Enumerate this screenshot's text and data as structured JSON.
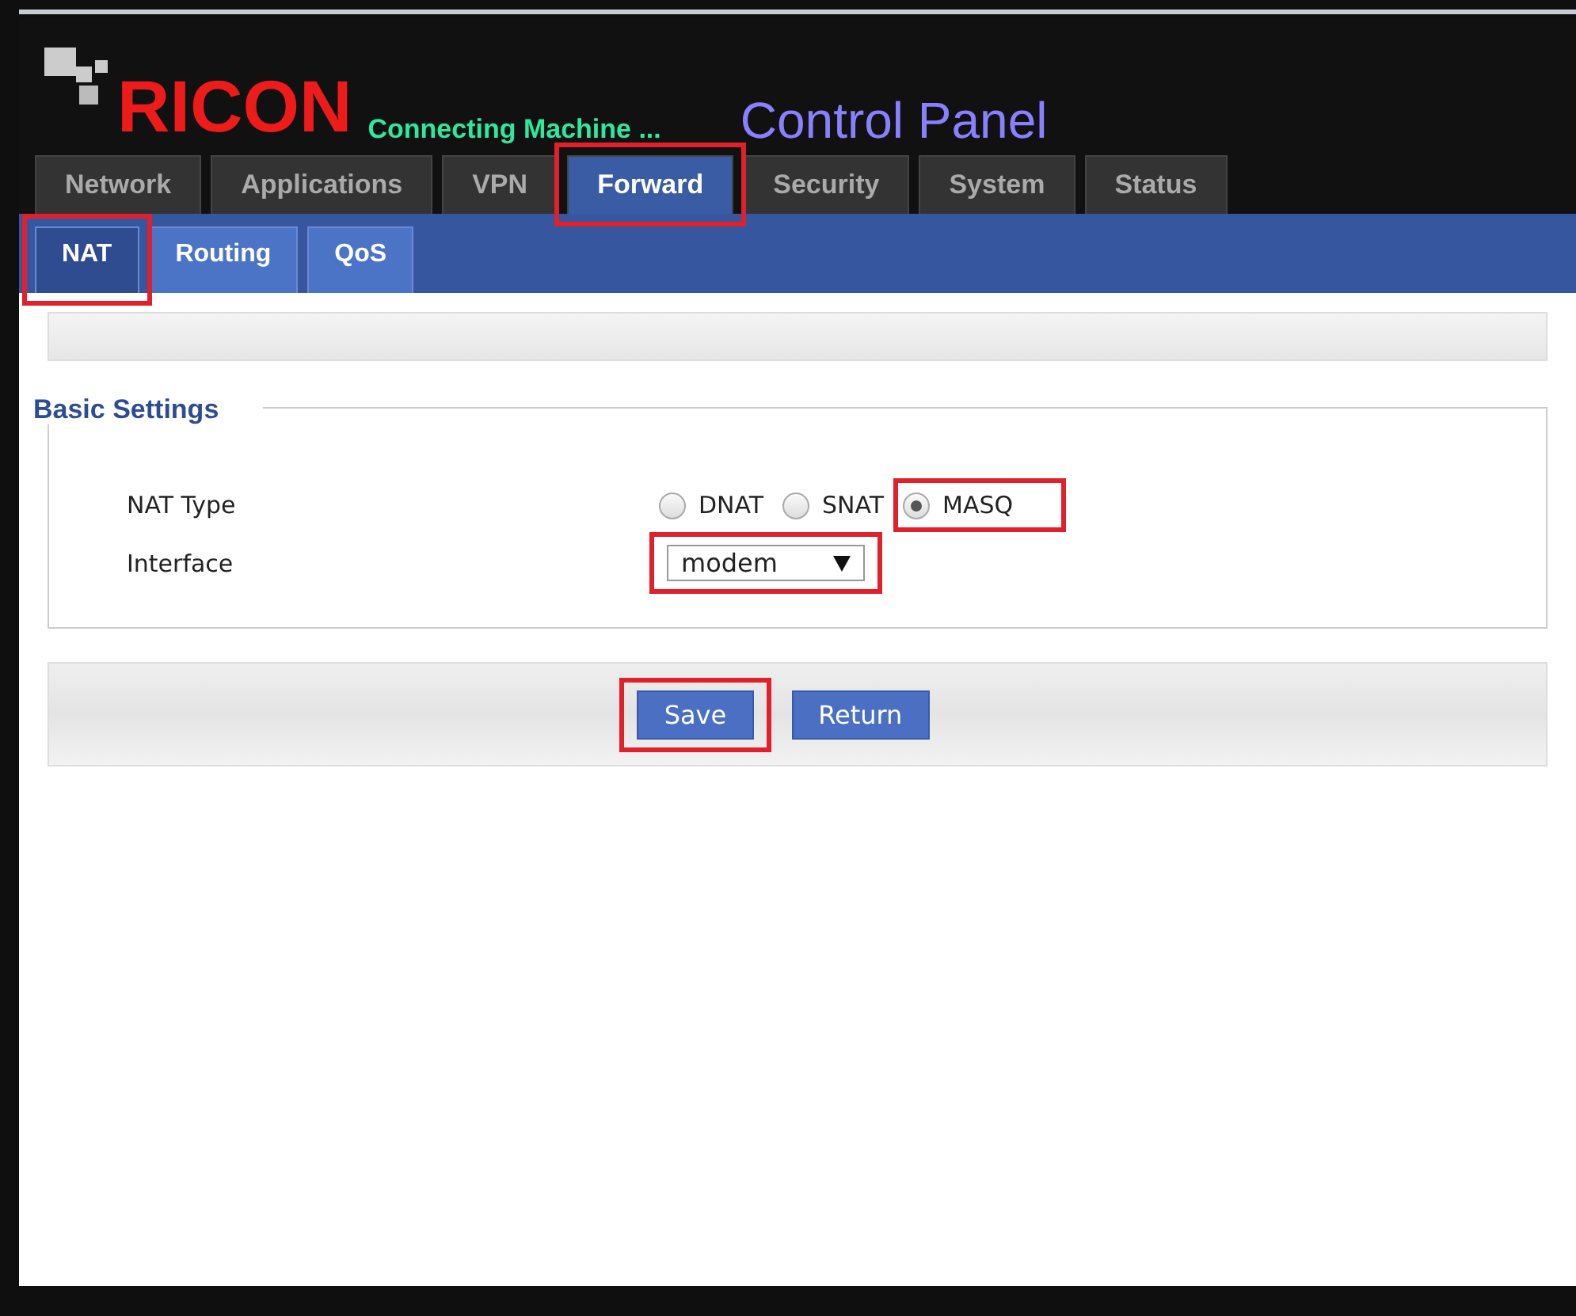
{
  "header": {
    "brand": "RICON",
    "tagline": "Connecting Machine ...",
    "title": "Control Panel"
  },
  "tabs": [
    {
      "label": "Network",
      "selected": false,
      "highlighted": false
    },
    {
      "label": "Applications",
      "selected": false,
      "highlighted": false
    },
    {
      "label": "VPN",
      "selected": false,
      "highlighted": false
    },
    {
      "label": "Forward",
      "selected": true,
      "highlighted": true
    },
    {
      "label": "Security",
      "selected": false,
      "highlighted": false
    },
    {
      "label": "System",
      "selected": false,
      "highlighted": false
    },
    {
      "label": "Status",
      "selected": false,
      "highlighted": false
    }
  ],
  "subtabs": [
    {
      "label": "NAT",
      "selected": true,
      "highlighted": true
    },
    {
      "label": "Routing",
      "selected": false,
      "highlighted": false
    },
    {
      "label": "QoS",
      "selected": false,
      "highlighted": false
    }
  ],
  "section": {
    "legend": "Basic Settings",
    "rows": [
      {
        "kind": "radio",
        "label": "NAT Type",
        "options": [
          {
            "label": "DNAT",
            "selected": false,
            "highlighted": false
          },
          {
            "label": "SNAT",
            "selected": false,
            "highlighted": false
          },
          {
            "label": "MASQ",
            "selected": true,
            "highlighted": true
          }
        ]
      },
      {
        "kind": "select",
        "label": "Interface",
        "value": "modem",
        "highlighted": true
      }
    ]
  },
  "buttons": [
    {
      "label": "Save",
      "highlighted": true
    },
    {
      "label": "Return",
      "highlighted": false
    }
  ]
}
